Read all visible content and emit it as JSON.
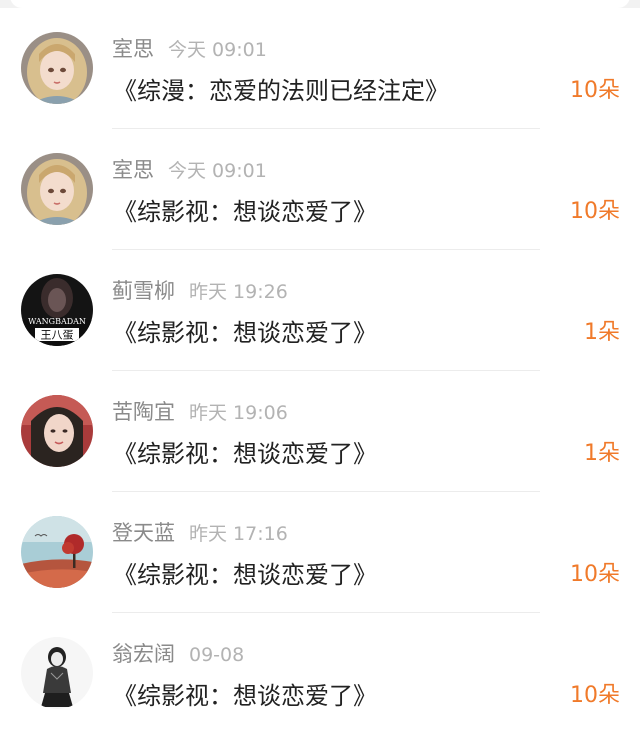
{
  "accent_color": "#f07a2a",
  "gifts": [
    {
      "username": "室思",
      "time": "今天 09:01",
      "book": "《综漫：恋爱的法则已经注定》",
      "count": "10朵",
      "avatar": "anime-girl-avatar"
    },
    {
      "username": "室思",
      "time": "今天 09:01",
      "book": "《综影视：想谈恋爱了》",
      "count": "10朵",
      "avatar": "anime-girl-avatar"
    },
    {
      "username": "蓟雪柳",
      "time": "昨天 19:26",
      "book": "《综影视：想谈恋爱了》",
      "count": "1朵",
      "avatar": "dark-portrait-avatar",
      "avatar_texts": [
        "WANGBADAN",
        "王八蛋"
      ]
    },
    {
      "username": "苦陶宜",
      "time": "昨天 19:06",
      "book": "《综影视：想谈恋爱了》",
      "count": "1朵",
      "avatar": "woman-portrait-avatar"
    },
    {
      "username": "登天蓝",
      "time": "昨天 17:16",
      "book": "《综影视：想谈恋爱了》",
      "count": "10朵",
      "avatar": "autumn-tree-avatar"
    },
    {
      "username": "翁宏阔",
      "time": "09-08",
      "book": "《综影视：想谈恋爱了》",
      "count": "10朵",
      "avatar": "sketch-girl-avatar"
    }
  ]
}
